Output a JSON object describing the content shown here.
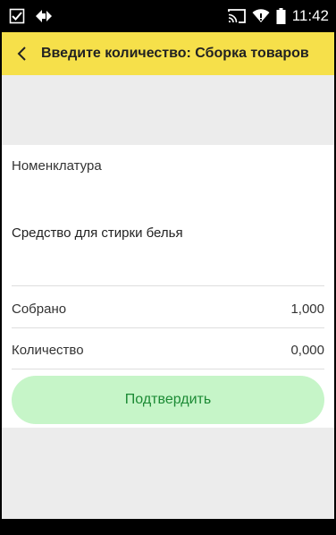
{
  "status_bar": {
    "time": "11:42",
    "icons": [
      "checkbox-notification-icon",
      "diamond-arrows-icon",
      "cast-icon",
      "wifi-icon",
      "battery-icon"
    ]
  },
  "app_bar": {
    "back_icon": "chevron-left-icon",
    "title": "Введите количество: Сборка товаров"
  },
  "item": {
    "header": "Номенклатура",
    "name": "Средство для стирки белья"
  },
  "fields": [
    {
      "label": "Собрано",
      "value": "1,000"
    },
    {
      "label": "Количество",
      "value": "0,000"
    }
  ],
  "confirm_button": {
    "label": "Подтвердить"
  },
  "colors": {
    "app_bar": "#f6e04a",
    "button_bg": "#c6f5c8",
    "button_text": "#1b8a34",
    "background_gray": "#ececec"
  }
}
